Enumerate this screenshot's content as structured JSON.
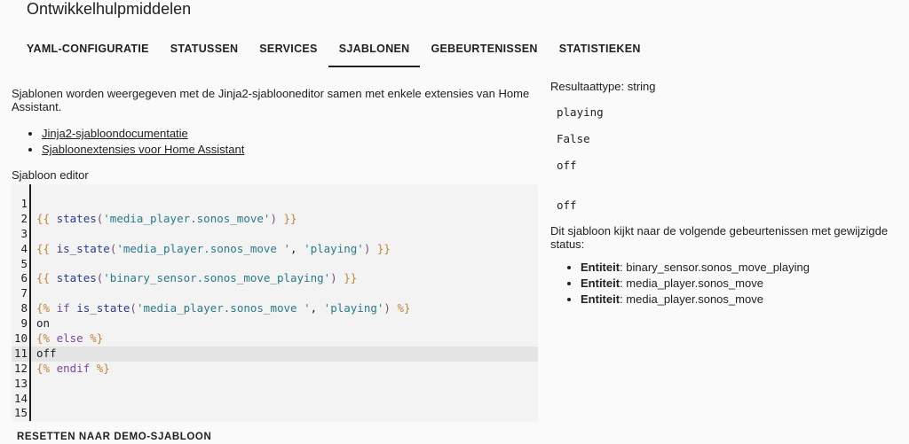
{
  "page": {
    "title": "Ontwikkelhulpmiddelen"
  },
  "tabs": [
    {
      "label": "YAML-CONFIGURATIE"
    },
    {
      "label": "STATUSSEN"
    },
    {
      "label": "SERVICES"
    },
    {
      "label": "SJABLONEN"
    },
    {
      "label": "GEBEURTENISSEN"
    },
    {
      "label": "STATISTIEKEN"
    }
  ],
  "intro": {
    "description": "Sjablonen worden weergegeven met de Jinja2-sjablooneditor samen met enkele extensies van Home Assistant.",
    "links": [
      {
        "label": "Jinja2-sjabloondocumentatie"
      },
      {
        "label": "Sjabloonextensies voor Home Assistant"
      }
    ],
    "editor_label": "Sjabloon editor"
  },
  "editor": {
    "line_numbers": [
      "1",
      "2",
      "3",
      "4",
      "5",
      "6",
      "7",
      "8",
      "9",
      "10",
      "11",
      "12",
      "13",
      "14",
      "15"
    ],
    "active_line": 11
  },
  "reset_button": "RESETTEN NAAR DEMO-SJABLOON",
  "result": {
    "type_label": "Resultaattype: string",
    "lines": [
      "playing",
      "",
      "False",
      "",
      "off",
      "",
      "",
      "off"
    ],
    "listener_text": "Dit sjabloon kijkt naar de volgende gebeurtenissen met gewijzigde status:",
    "entities": [
      {
        "prefix": "Entiteit",
        "value": ": binary_sensor.sonos_move_playing"
      },
      {
        "prefix": "Entiteit",
        "value": ": media_player.sonos_move"
      },
      {
        "prefix": "Entiteit",
        "value": ": media_player.sonos_move"
      }
    ]
  }
}
